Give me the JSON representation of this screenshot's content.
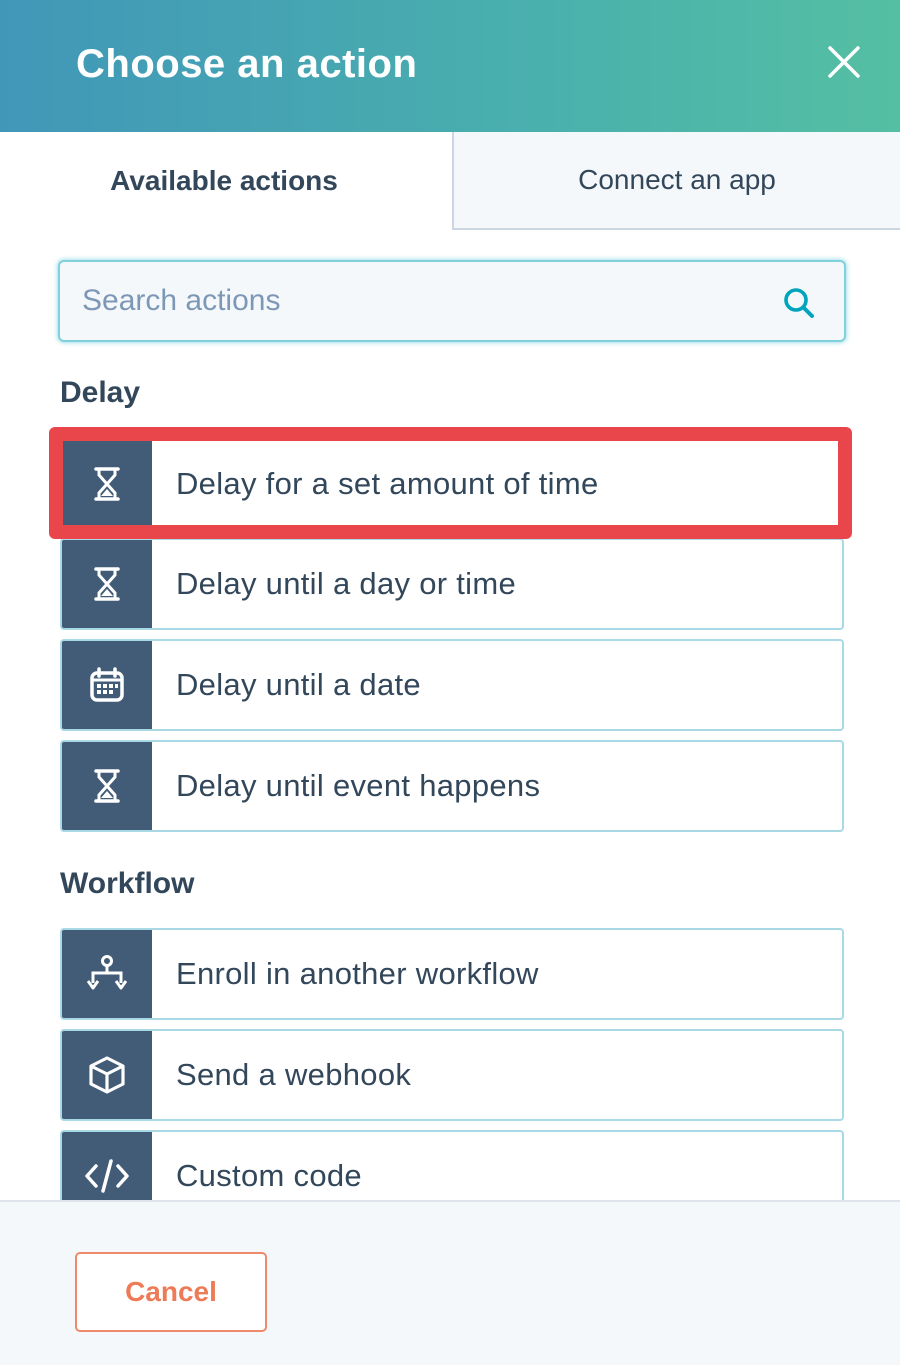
{
  "header": {
    "title": "Choose an action",
    "close_icon": "close-icon"
  },
  "tabs": [
    {
      "label": "Available actions",
      "active": true
    },
    {
      "label": "Connect an app",
      "active": false
    }
  ],
  "search": {
    "placeholder": "Search actions",
    "value": "",
    "icon": "search-icon"
  },
  "sections": [
    {
      "title": "Delay",
      "items": [
        {
          "label": "Delay for a set amount of time",
          "icon": "hourglass-icon",
          "highlighted": true
        },
        {
          "label": "Delay until a day or time",
          "icon": "hourglass-icon"
        },
        {
          "label": "Delay until a date",
          "icon": "calendar-icon"
        },
        {
          "label": "Delay until event happens",
          "icon": "hourglass-icon"
        }
      ]
    },
    {
      "title": "Workflow",
      "items": [
        {
          "label": "Enroll in another workflow",
          "icon": "workflow-icon"
        },
        {
          "label": "Send a webhook",
          "icon": "cube-icon"
        },
        {
          "label": "Custom code",
          "icon": "code-icon"
        }
      ]
    }
  ],
  "footer": {
    "cancel_label": "Cancel"
  },
  "colors": {
    "header_start": "#4197b8",
    "header_end": "#55bfa3",
    "icon_panel": "#425b76",
    "highlight": "#e8464a",
    "cancel": "#ee7b57"
  }
}
